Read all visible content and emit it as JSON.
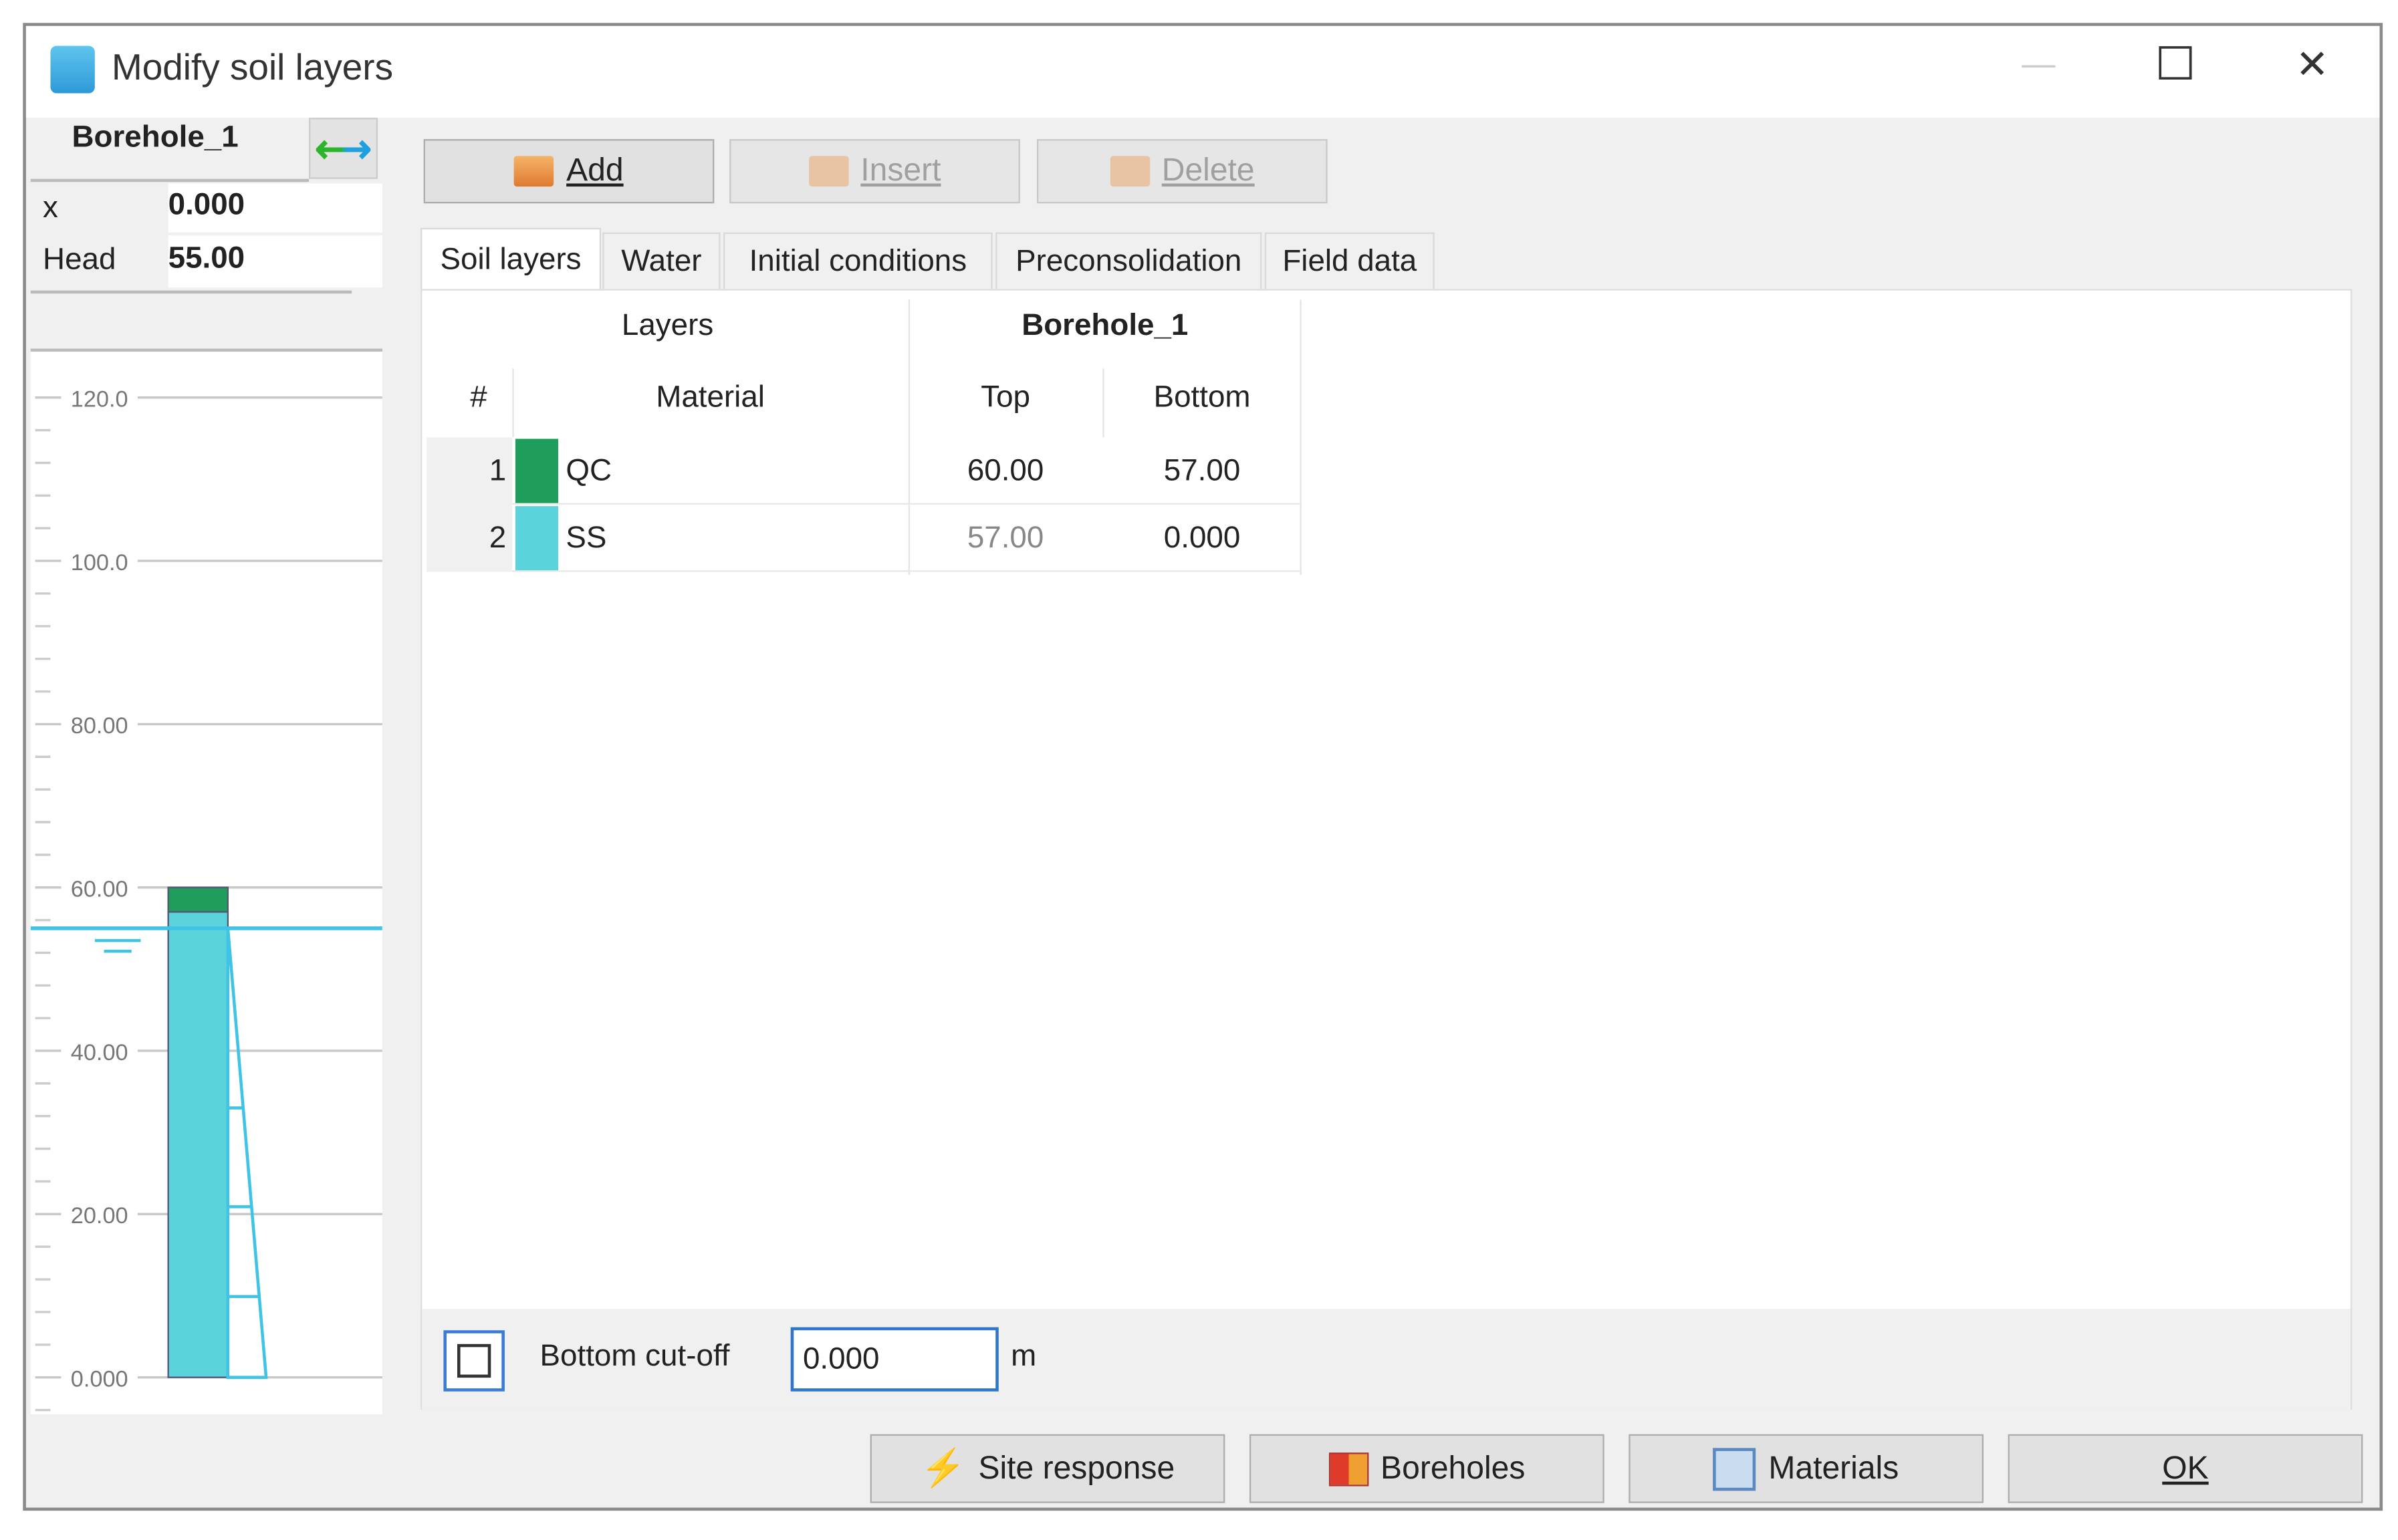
{
  "window": {
    "title": "Modify soil layers",
    "minimize": "—",
    "maximize": "☐",
    "close": "✕"
  },
  "left_panel": {
    "borehole_name": "Borehole_1",
    "fields": [
      {
        "label": "x",
        "value": "0.000"
      },
      {
        "label": "Head",
        "value": "55.00"
      }
    ]
  },
  "chart_data": {
    "type": "borehole-column",
    "y_ticks": [
      {
        "value": 120,
        "label": "120.0"
      },
      {
        "value": 100,
        "label": "100.0"
      },
      {
        "value": 80,
        "label": "80.00"
      },
      {
        "value": 60,
        "label": "60.00"
      },
      {
        "value": 40,
        "label": "40.00"
      },
      {
        "value": 20,
        "label": "20.00"
      },
      {
        "value": 0,
        "label": "0.000"
      }
    ],
    "ylim": [
      -4,
      122
    ],
    "minor_step": 4,
    "layers": [
      {
        "material": "QC",
        "top": 60,
        "bottom": 57,
        "color": "#1e9e5a"
      },
      {
        "material": "SS",
        "top": 57,
        "bottom": 0,
        "color": "#5ad3da"
      }
    ],
    "head": 55,
    "water_color": "#3fc3e6"
  },
  "toolbar": {
    "add": "Add",
    "insert": "Insert",
    "delete": "Delete"
  },
  "tabs": [
    "Soil layers",
    "Water",
    "Initial conditions",
    "Preconsolidation",
    "Field data"
  ],
  "table": {
    "group_layers": "Layers",
    "group_borehole": "Borehole_1",
    "headers": {
      "num": "#",
      "material": "Material",
      "top": "Top",
      "bottom": "Bottom"
    },
    "rows": [
      {
        "num": "1",
        "material": "QC",
        "color": "#1e9e5a",
        "top": "60.00",
        "bottom": "57.00"
      },
      {
        "num": "2",
        "material": "SS",
        "color": "#5ad3da",
        "top": "57.00",
        "bottom": "0.000"
      }
    ]
  },
  "cutoff": {
    "label": "Bottom cut-off",
    "value": "0.000",
    "unit": "m",
    "checked": false
  },
  "footer": {
    "site_response": "Site response",
    "boreholes": "Boreholes",
    "materials": "Materials",
    "ok": "OK"
  }
}
